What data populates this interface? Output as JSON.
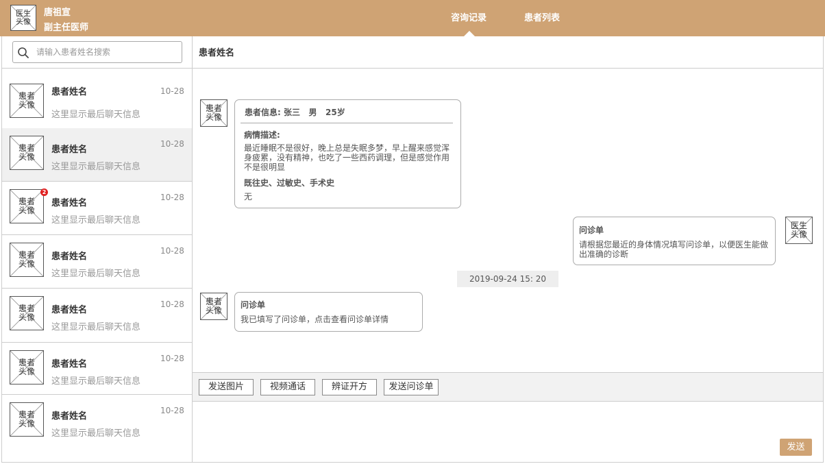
{
  "header": {
    "doctor_avatar_text": "医生\n头像",
    "doctor_name": "唐祖宣",
    "doctor_title": "副主任医师",
    "tabs": [
      {
        "label": "咨询记录",
        "active": true
      },
      {
        "label": "患者列表",
        "active": false
      }
    ]
  },
  "search": {
    "placeholder": "请输入患者姓名搜索",
    "value": ""
  },
  "patients": [
    {
      "avatar_text": "患者\n头像",
      "name": "患者姓名",
      "date": "10-28",
      "last_message": "这里显示最后聊天信息",
      "active": false,
      "unread": null
    },
    {
      "avatar_text": "患者\n头像",
      "name": "患者姓名",
      "date": "10-28",
      "last_message": "这里显示最后聊天信息",
      "active": true,
      "unread": null
    },
    {
      "avatar_text": "患者\n头像",
      "name": "患者姓名",
      "date": "10-28",
      "last_message": "这里显示最后聊天信息",
      "active": false,
      "unread": "2"
    },
    {
      "avatar_text": "患者\n头像",
      "name": "患者姓名",
      "date": "10-28",
      "last_message": "这里显示最后聊天信息",
      "active": false,
      "unread": null
    },
    {
      "avatar_text": "患者\n头像",
      "name": "患者姓名",
      "date": "10-28",
      "last_message": "这里显示最后聊天信息",
      "active": false,
      "unread": null
    },
    {
      "avatar_text": "患者\n头像",
      "name": "患者姓名",
      "date": "10-28",
      "last_message": "这里显示最后聊天信息",
      "active": false,
      "unread": null
    },
    {
      "avatar_text": "患者\n头像",
      "name": "患者姓名",
      "date": "10-28",
      "last_message": "这里显示最后聊天信息",
      "active": false,
      "unread": null
    }
  ],
  "chat": {
    "title": "患者姓名",
    "messages": {
      "patient_info": {
        "avatar_text": "患者\n头像",
        "header": "患者信息: 张三   男   25岁",
        "desc_label": "病情描述:",
        "desc_text": "最近睡眠不是很好，晚上总是失眠多梦，早上醒来感觉浑身疲累，没有精神，也吃了一些西药调理，但是感觉作用不是很明显",
        "history_label": "既往史、过敏史、手术史",
        "history_value": "无"
      },
      "doctor_form": {
        "avatar_text": "医生\n头像",
        "title": "问诊单",
        "text": "请根据您最近的身体情况填写问诊单，以便医生能做出准确的诊断"
      },
      "timestamp": "2019-09-24 15: 20",
      "patient_form": {
        "avatar_text": "患者\n头像",
        "title": "问诊单",
        "text": "我已填写了问诊单，点击查看问诊单详情"
      }
    },
    "toolbar": [
      "发送图片",
      "视频通话",
      "辨证开方",
      "发送问诊单"
    ],
    "compose_value": "",
    "send_label": "发送"
  },
  "colors": {
    "brand": "#cfa374",
    "badge": "#e02020",
    "active_row": "#f0f0f0"
  }
}
